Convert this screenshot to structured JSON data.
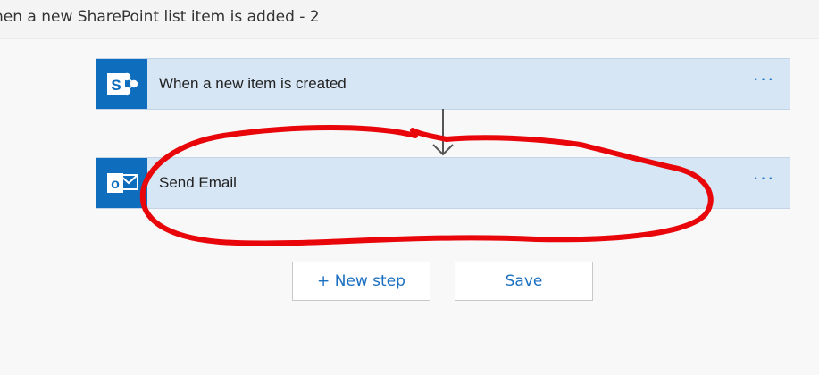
{
  "header": {
    "title": "hen a new SharePoint list item is added - 2"
  },
  "steps": [
    {
      "label": "When a new item is created",
      "icon": "sharepoint-icon",
      "icon_letter": "S",
      "menu": "···"
    },
    {
      "label": "Send Email",
      "icon": "outlook-icon",
      "icon_letter": "o",
      "menu": "···"
    }
  ],
  "actions": {
    "new_step": "+ New step",
    "save": "Save"
  },
  "colors": {
    "card_bg": "#d6e6f5",
    "icon_bg": "#0f6dbd",
    "accent": "#1a6fc0",
    "annotation": "#e8060a"
  }
}
